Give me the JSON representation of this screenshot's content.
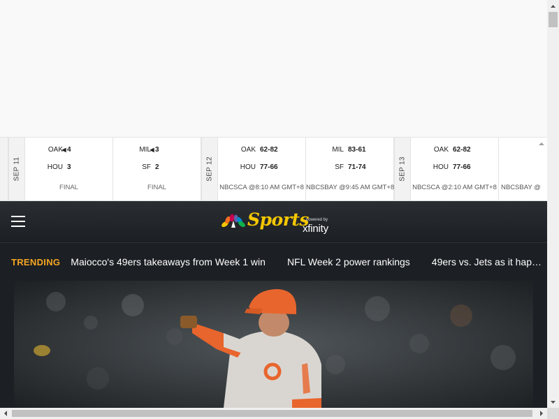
{
  "scoreboard": {
    "dates": [
      "SEP 11",
      "SEP 12",
      "SEP 13"
    ],
    "games": [
      {
        "away": "OAK",
        "away_score": "4",
        "home": "HOU",
        "home_score": "3",
        "winner_marker": "◀",
        "status": "FINAL"
      },
      {
        "away": "MIL",
        "away_score": "3",
        "home": "SF",
        "home_score": "2",
        "winner_marker": "◀",
        "status": "FINAL"
      },
      {
        "away": "OAK",
        "away_record": "62-82",
        "home": "HOU",
        "home_record": "77-66",
        "status": "NBCSCA @8:10 AM GMT+8"
      },
      {
        "away": "MIL",
        "away_record": "83-61",
        "home": "SF",
        "home_record": "71-74",
        "status": "NBCSBAY @9:45 AM GMT+8"
      },
      {
        "away": "OAK",
        "away_record": "62-82",
        "home": "HOU",
        "home_record": "77-66",
        "status": "NBCSCA @2:10 AM GMT+8"
      },
      {
        "status": "NBCSBAY @"
      }
    ]
  },
  "header": {
    "logo_word": "Sports",
    "powered_by": "powered by",
    "xfinity": "xfinity"
  },
  "trending": {
    "label": "TRENDING",
    "links": [
      "Maiocco's 49ers takeaways from Week 1 win",
      "NFL Week 2 power rankings",
      "49ers vs. Jets as it hap…"
    ]
  },
  "colors": {
    "nav_bg": "#1c1f23",
    "trending_label": "#f5a623",
    "logo": "#f5c700",
    "jersey_accent": "#e8652d"
  }
}
